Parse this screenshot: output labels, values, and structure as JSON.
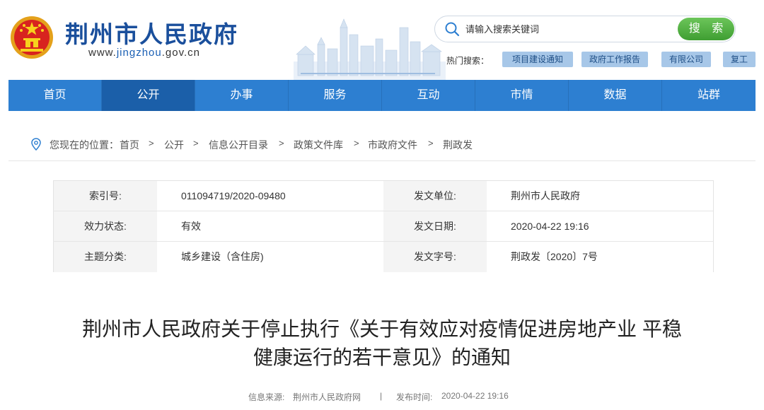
{
  "header": {
    "site_name": "荆州市人民政府",
    "url_prefix": "www.",
    "url_highlight": "jingzhou",
    "url_suffix": ".gov.cn"
  },
  "search": {
    "placeholder": "请输入搜索关键词",
    "button_label": "搜 索",
    "hot_label": "热门搜索：",
    "hot_tags": [
      "项目建设通知",
      "政府工作报告",
      "有限公司",
      "复工"
    ]
  },
  "nav": {
    "items": [
      "首页",
      "公开",
      "办事",
      "服务",
      "互动",
      "市情",
      "数据",
      "站群"
    ],
    "active": "公开"
  },
  "breadcrumb": {
    "prefix": "您现在的位置：",
    "items": [
      "首页",
      "公开",
      "信息公开目录",
      "政策文件库",
      "市政府文件",
      "荆政发"
    ],
    "separator": ">"
  },
  "info": {
    "index_label": "索引号:",
    "index_value": "011094719/2020-09480",
    "issuer_label": "发文单位:",
    "issuer_value": "荆州市人民政府",
    "status_label": "效力状态:",
    "status_value": "有效",
    "date_label": "发文日期:",
    "date_value": "2020-04-22 19:16",
    "topic_label": "主题分类:",
    "topic_value": "城乡建设（含住房)",
    "docno_label": "发文字号:",
    "docno_value": "荆政发〔2020〕7号"
  },
  "article": {
    "title_line1": "荆州市人民政府关于停止执行《关于有效应对疫情促进房地产业 平稳",
    "title_line2": "健康运行的若干意见》的通知",
    "source_label": "信息来源:",
    "source_value": "荆州市人民政府网",
    "divider": "|",
    "time_label": "发布时间:",
    "time_value": "2020-04-22 19:16"
  },
  "colors": {
    "nav_blue": "#2d7fd1",
    "nav_active": "#1b5fa9",
    "brand_blue": "#1a4f9c",
    "search_green": "#4cae3c",
    "tag_bg": "#a7c7e8"
  }
}
